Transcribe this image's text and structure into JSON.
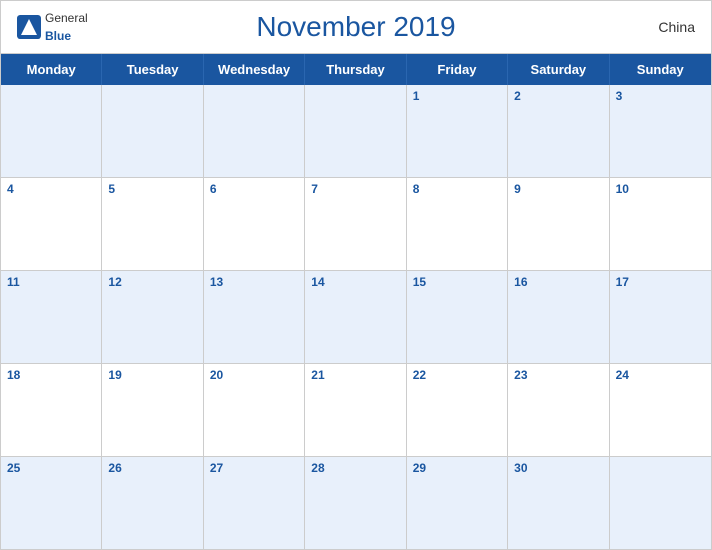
{
  "header": {
    "title": "November 2019",
    "country": "China",
    "logo": {
      "general": "General",
      "blue": "Blue"
    }
  },
  "days_of_week": [
    "Monday",
    "Tuesday",
    "Wednesday",
    "Thursday",
    "Friday",
    "Saturday",
    "Sunday"
  ],
  "weeks": [
    [
      {
        "day": "",
        "empty": true
      },
      {
        "day": "",
        "empty": true
      },
      {
        "day": "",
        "empty": true
      },
      {
        "day": "",
        "empty": true
      },
      {
        "day": "1",
        "empty": false
      },
      {
        "day": "2",
        "empty": false
      },
      {
        "day": "3",
        "empty": false
      }
    ],
    [
      {
        "day": "4",
        "empty": false
      },
      {
        "day": "5",
        "empty": false
      },
      {
        "day": "6",
        "empty": false
      },
      {
        "day": "7",
        "empty": false
      },
      {
        "day": "8",
        "empty": false
      },
      {
        "day": "9",
        "empty": false
      },
      {
        "day": "10",
        "empty": false
      }
    ],
    [
      {
        "day": "11",
        "empty": false
      },
      {
        "day": "12",
        "empty": false
      },
      {
        "day": "13",
        "empty": false
      },
      {
        "day": "14",
        "empty": false
      },
      {
        "day": "15",
        "empty": false
      },
      {
        "day": "16",
        "empty": false
      },
      {
        "day": "17",
        "empty": false
      }
    ],
    [
      {
        "day": "18",
        "empty": false
      },
      {
        "day": "19",
        "empty": false
      },
      {
        "day": "20",
        "empty": false
      },
      {
        "day": "21",
        "empty": false
      },
      {
        "day": "22",
        "empty": false
      },
      {
        "day": "23",
        "empty": false
      },
      {
        "day": "24",
        "empty": false
      }
    ],
    [
      {
        "day": "25",
        "empty": false
      },
      {
        "day": "26",
        "empty": false
      },
      {
        "day": "27",
        "empty": false
      },
      {
        "day": "28",
        "empty": false
      },
      {
        "day": "29",
        "empty": false
      },
      {
        "day": "30",
        "empty": false
      },
      {
        "day": "",
        "empty": true
      }
    ]
  ]
}
